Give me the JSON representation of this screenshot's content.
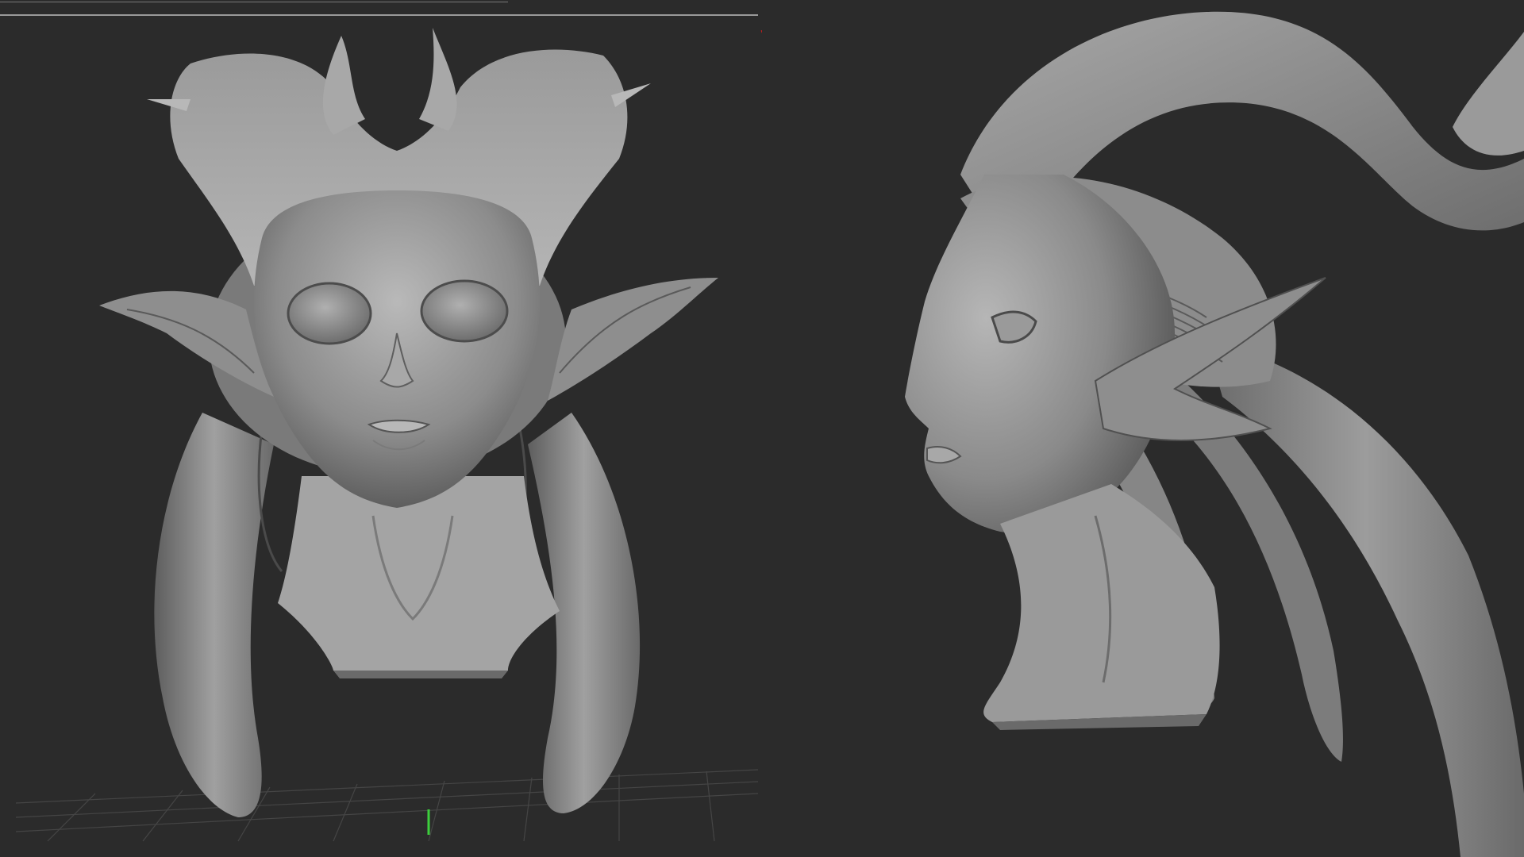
{
  "scene": {
    "background_color": "#2b2b2b",
    "model_color": "#8f8f8f",
    "model_highlight": "#c4c4c4",
    "model_shadow": "#3a3a3a",
    "grid_color": "#4a4a4a",
    "axis_marker_color": "#3ccf3c",
    "gizmo_color": "#c41e1e"
  },
  "viewports": [
    {
      "view": "front",
      "subject": "demon-head-sculpt"
    },
    {
      "view": "side",
      "subject": "demon-head-sculpt"
    }
  ],
  "icons": {
    "gizmo": "rotation-gizmo-icon",
    "axis": "axis-marker-icon"
  }
}
